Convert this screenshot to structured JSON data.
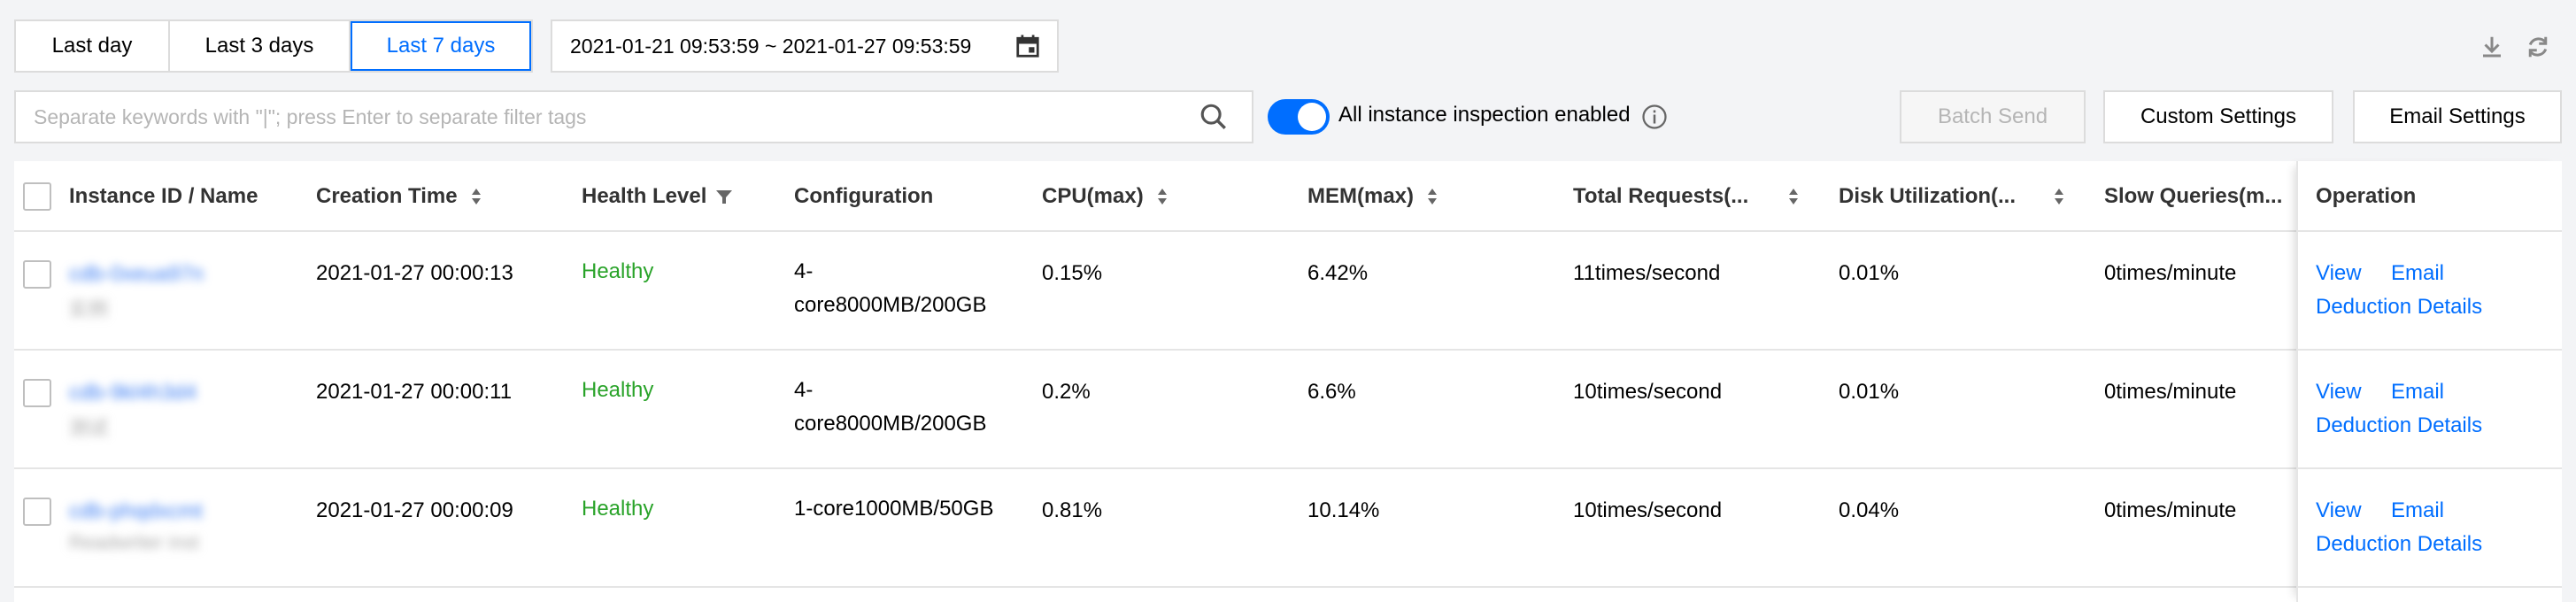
{
  "time_range": {
    "options": [
      "Last day",
      "Last 3 days",
      "Last 7 days"
    ],
    "selected": "Last 7 days",
    "date_range": "2021-01-21 09:53:59 ~ 2021-01-27 09:53:59"
  },
  "toolbar": {
    "search_placeholder": "Separate keywords with \"|\"; press Enter to separate filter tags",
    "toggle_on": true,
    "toggle_label": "All instance inspection enabled",
    "batch_send_label": "Batch Send",
    "custom_settings_label": "Custom Settings",
    "email_settings_label": "Email Settings"
  },
  "table": {
    "headers": {
      "instance": "Instance ID / Name",
      "creation_time": "Creation Time",
      "health_level": "Health Level",
      "configuration": "Configuration",
      "cpu": "CPU(max)",
      "mem": "MEM(max)",
      "total_requests": "Total Requests(...",
      "disk": "Disk Utilization(...",
      "slow_queries": "Slow Queries(m...",
      "operation": "Operation"
    },
    "rows": [
      {
        "instance_id": "cdb-0xeua97n",
        "instance_name": "实例",
        "creation_time": "2021-01-27 00:00:13",
        "health": "Healthy",
        "config_line1": "4-",
        "config_line2": "core8000MB/200GB",
        "cpu": "0.15%",
        "mem": "6.42%",
        "total_requests": "11times/second",
        "disk": "0.01%",
        "slow_queries": "0times/minute",
        "op_view": "View",
        "op_email": "Email",
        "op_deduction": "Deduction Details"
      },
      {
        "instance_id": "cdb-9kl4h3d4",
        "instance_name": "测试",
        "creation_time": "2021-01-27 00:00:11",
        "health": "Healthy",
        "config_line1": "4-",
        "config_line2": "core8000MB/200GB",
        "cpu": "0.2%",
        "mem": "6.6%",
        "total_requests": "10times/second",
        "disk": "0.01%",
        "slow_queries": "0times/minute",
        "op_view": "View",
        "op_email": "Email",
        "op_deduction": "Deduction Details"
      },
      {
        "instance_id": "cdb-phqdxcmt",
        "instance_name": "Readwriter inst",
        "creation_time": "2021-01-27 00:00:09",
        "health": "Healthy",
        "config_line1": "1-core1000MB/50GB",
        "config_line2": "",
        "cpu": "0.81%",
        "mem": "10.14%",
        "total_requests": "10times/second",
        "disk": "0.04%",
        "slow_queries": "0times/minute",
        "op_view": "View",
        "op_email": "Email",
        "op_deduction": "Deduction Details"
      }
    ]
  },
  "colors": {
    "accent": "#006eff",
    "healthy": "#29a329",
    "border": "#dcdcdc"
  },
  "icons": [
    "calendar-icon",
    "download-icon",
    "refresh-icon",
    "search-icon",
    "info-icon",
    "sort-icon",
    "filter-icon"
  ]
}
